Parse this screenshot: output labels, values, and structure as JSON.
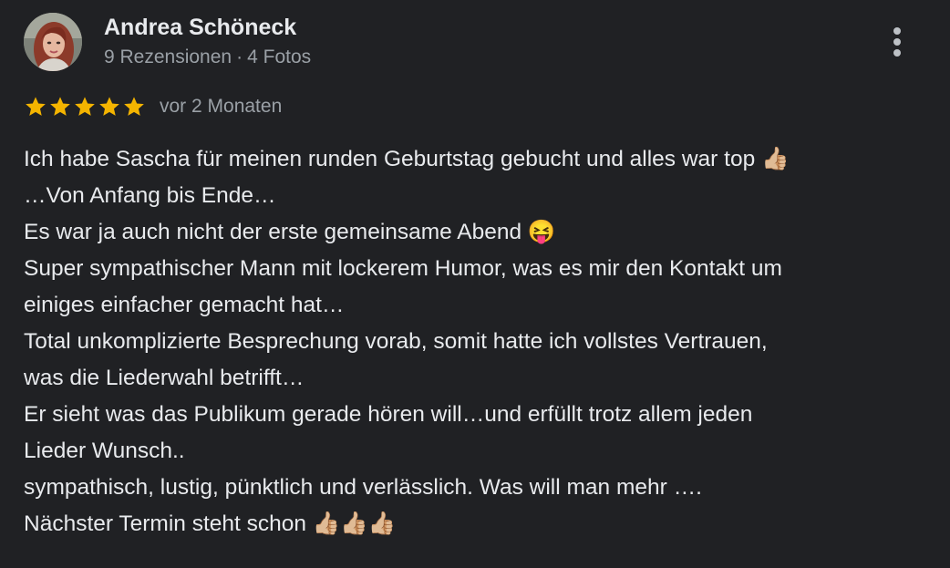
{
  "reviewer": {
    "name": "Andrea Schöneck",
    "reviews": "9 Rezensionen",
    "separator": "·",
    "photos": "4 Fotos"
  },
  "rating": {
    "stars": 5,
    "max_stars": 5,
    "star_color": "#f4b400",
    "date": "vor 2 Monaten"
  },
  "review": {
    "lines": [
      "Ich habe Sascha für meinen runden Geburtstag gebucht und alles war top 👍🏼",
      "…Von Anfang bis Ende…",
      "Es war ja auch nicht der erste gemeinsame Abend 😝",
      "Super sympathischer Mann mit lockerem Humor, was es mir den Kontakt um",
      "einiges einfacher gemacht hat…",
      "Total unkomplizierte Besprechung vorab, somit hatte ich vollstes Vertrauen,",
      "was die Liederwahl betrifft…",
      "Er sieht was das Publikum gerade hören will…und erfüllt trotz allem jeden",
      "Lieder Wunsch..",
      "sympathisch, lustig, pünktlich und verlässlich. Was will man mehr ….",
      "Nächster Termin steht schon 👍🏼👍🏼👍🏼"
    ]
  },
  "icons": {
    "more": "more-vertical-icon",
    "star": "star-icon",
    "avatar": "user-avatar-photo"
  },
  "colors": {
    "background": "#202124",
    "primary_text": "#e8eaed",
    "secondary_text": "#9aa0a6"
  }
}
